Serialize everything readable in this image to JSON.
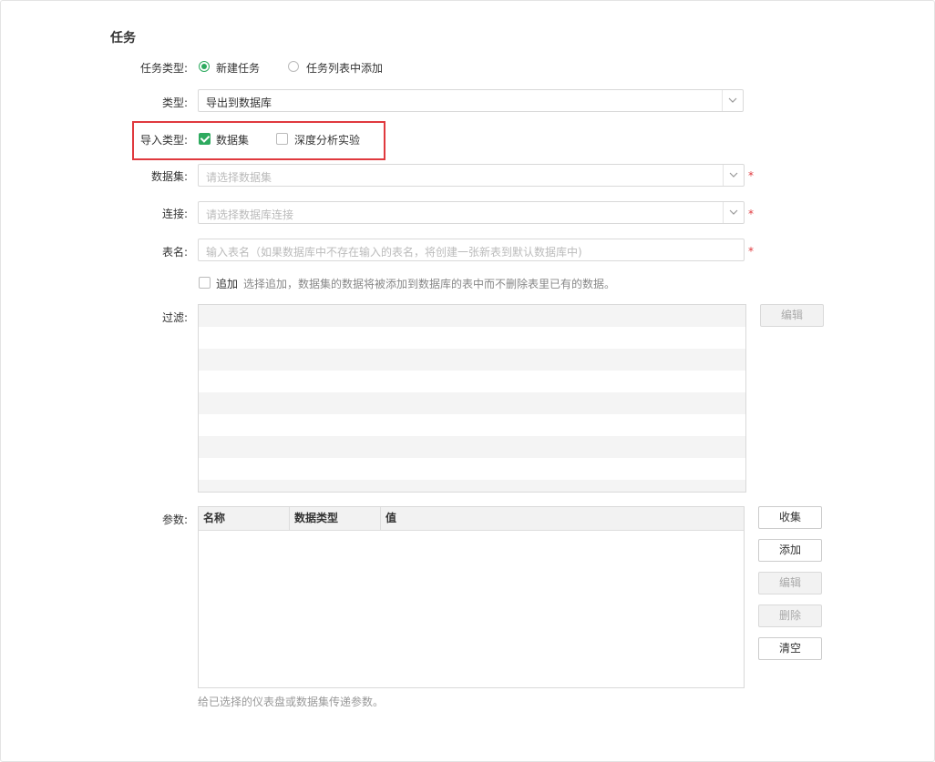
{
  "section_title": "任务",
  "task_type": {
    "label": "任务类型:",
    "options": [
      {
        "label": "新建任务",
        "selected": true
      },
      {
        "label": "任务列表中添加",
        "selected": false
      }
    ]
  },
  "type": {
    "label": "类型:",
    "value": "导出到数据库"
  },
  "import_type": {
    "label": "导入类型:",
    "options": [
      {
        "label": "数据集",
        "checked": true
      },
      {
        "label": "深度分析实验",
        "checked": false
      }
    ]
  },
  "dataset": {
    "label": "数据集:",
    "placeholder": "请选择数据集",
    "required": "*"
  },
  "connection": {
    "label": "连接:",
    "placeholder": "请选择数据库连接",
    "required": "*"
  },
  "table_name": {
    "label": "表名:",
    "placeholder": "输入表名（如果数据库中不存在输入的表名，将创建一张新表到默认数据库中)",
    "required": "*"
  },
  "append": {
    "label": "追加",
    "checked": false,
    "hint": "选择追加，数据集的数据将被添加到数据库的表中而不删除表里已有的数据。"
  },
  "filter": {
    "label": "过滤:",
    "edit_button": "编辑"
  },
  "params": {
    "label": "参数:",
    "columns": [
      "名称",
      "数据类型",
      "值"
    ],
    "buttons": {
      "collect": "收集",
      "add": "添加",
      "edit": "编辑",
      "delete": "删除",
      "clear": "清空"
    },
    "hint": "给已选择的仪表盘或数据集传递参数。"
  },
  "colors": {
    "accent": "#2eaa5f",
    "highlight_border": "#e0393e",
    "required": "#e0393e"
  }
}
